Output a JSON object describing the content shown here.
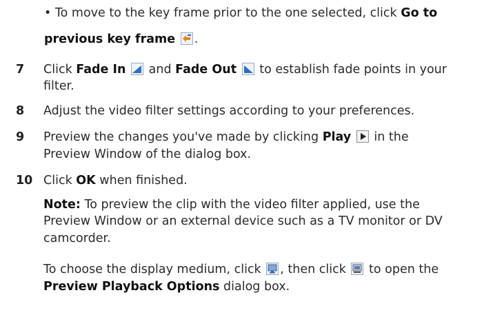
{
  "bullet": {
    "text_before": "To move to the key frame prior to the one selected, click",
    "bold1": "Go to",
    "bold2": "previous key frame",
    "icon": "previous-key-frame-icon",
    "text_after": "."
  },
  "step7": {
    "num": "7",
    "t1": "Click",
    "fade_in": "Fade In",
    "fade_in_icon": "fade-in-icon",
    "t2": "and",
    "fade_out": "Fade Out",
    "fade_out_icon": "fade-out-icon",
    "t3": "to establish fade points in your",
    "t4": "filter."
  },
  "step8": {
    "num": "8",
    "text": "Adjust the video filter settings according to your preferences."
  },
  "step9": {
    "num": "9",
    "t1": "Preview the changes you've made by clicking",
    "play": "Play",
    "play_icon": "play-icon",
    "t2": "in the",
    "t3": "Preview Window of the dialog box."
  },
  "step10": {
    "num": "10",
    "t1": "Click",
    "ok": "OK",
    "t2": "when finished."
  },
  "note": {
    "label": "Note:",
    "l1": "To preview the clip with the video filter applied, use the",
    "l2": "Preview Window or an external device such as a TV monitor or DV",
    "l3": "camcorder."
  },
  "display": {
    "t1": "To choose the display medium, click",
    "icon1": "display-monitor-icon",
    "t2": ", then click",
    "icon2": "playback-options-icon",
    "t3": "to open the",
    "bold": "Preview Playback Options",
    "t4": "dialog box."
  }
}
